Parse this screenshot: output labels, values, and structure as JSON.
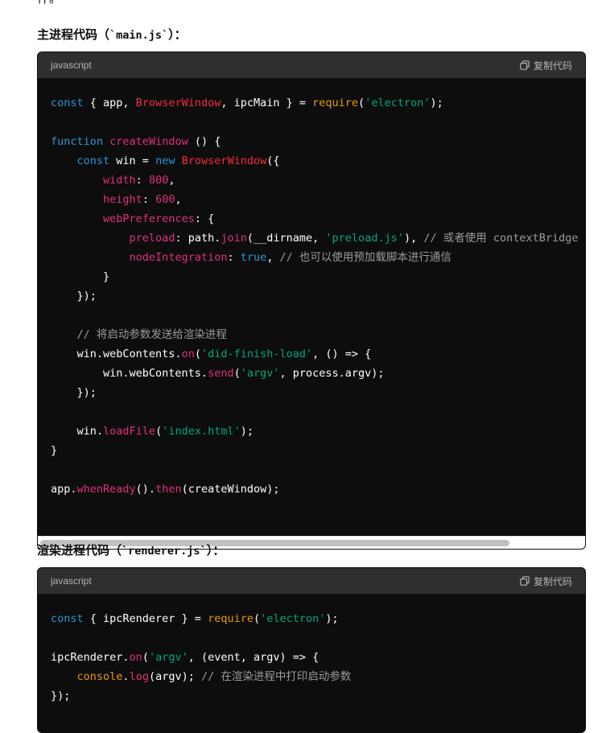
{
  "top_fragment": "件。",
  "section1": {
    "heading_prefix": "主进程代码（",
    "heading_code": "`main.js`",
    "heading_suffix": "）：",
    "language": "javascript",
    "copy_label": "复制代码"
  },
  "section2": {
    "heading_prefix": "渲染进程代码（",
    "heading_code": "`renderer.js`",
    "heading_suffix": "）：",
    "language": "javascript",
    "copy_label": "复制代码"
  },
  "code1": {
    "l1_kw": "const",
    "l1_a": " { app, ",
    "l1_cls": "BrowserWindow",
    "l1_b": ", ipcMain } = ",
    "l1_req": "require",
    "l1_c": "(",
    "l1_str": "'electron'",
    "l1_d": ");",
    "l3_kw": "function",
    "l3_a": " ",
    "l3_fn": "createWindow",
    "l3_b": " () {",
    "l4_a": "    ",
    "l4_kw": "const",
    "l4_b": " win = ",
    "l4_kw2": "new",
    "l4_c": " ",
    "l4_cls": "BrowserWindow",
    "l4_d": "({",
    "l5_a": "        ",
    "l5_prop": "width",
    "l5_b": ": ",
    "l5_num": "800",
    "l5_c": ",",
    "l6_a": "        ",
    "l6_prop": "height",
    "l6_b": ": ",
    "l6_num": "600",
    "l6_c": ",",
    "l7_a": "        ",
    "l7_prop": "webPreferences",
    "l7_b": ": {",
    "l8_a": "            ",
    "l8_prop": "preload",
    "l8_b": ": path.",
    "l8_fn": "join",
    "l8_c": "(__dirname, ",
    "l8_str": "'preload.js'",
    "l8_d": "), ",
    "l8_cm": "// 或者使用 contextBridge",
    "l9_a": "            ",
    "l9_prop": "nodeIntegration",
    "l9_b": ": ",
    "l9_kw": "true",
    "l9_c": ", ",
    "l9_cm": "// 也可以使用预加载脚本进行通信",
    "l10": "        }",
    "l11": "    });",
    "l13_a": "    ",
    "l13_cm": "// 将启动参数发送给渲染进程",
    "l14_a": "    win.webContents.",
    "l14_fn": "on",
    "l14_b": "(",
    "l14_str": "'did-finish-load'",
    "l14_c": ", () => {",
    "l15_a": "        win.webContents.",
    "l15_fn": "send",
    "l15_b": "(",
    "l15_str": "'argv'",
    "l15_c": ", process.argv);",
    "l16": "    });",
    "l18_a": "    win.",
    "l18_fn": "loadFile",
    "l18_b": "(",
    "l18_str": "'index.html'",
    "l18_c": ");",
    "l19": "}",
    "l21_a": "app.",
    "l21_fn": "whenReady",
    "l21_b": "().",
    "l21_fn2": "then",
    "l21_c": "(createWindow);"
  },
  "code2": {
    "l1_kw": "const",
    "l1_a": " { ipcRenderer } = ",
    "l1_req": "require",
    "l1_b": "(",
    "l1_str": "'electron'",
    "l1_c": ");",
    "l3_a": "ipcRenderer.",
    "l3_fn": "on",
    "l3_b": "(",
    "l3_str": "'argv'",
    "l3_c": ", (event, argv) => {",
    "l4_a": "    ",
    "l4_cls": "console",
    "l4_b": ".",
    "l4_fn": "log",
    "l4_c": "(argv); ",
    "l4_cm": "// 在渲染进程中打印启动参数",
    "l5": "});"
  },
  "colors": {
    "keyword": "#2e95d3",
    "class": "#f22c3d",
    "function": "#df3079",
    "string": "#00a67d",
    "comment": "#9b9b9b",
    "require": "#e9950c",
    "code_bg": "#0d0d0d",
    "header_bg": "#2f2f2f"
  },
  "icons": {
    "copy": "copy-icon"
  }
}
